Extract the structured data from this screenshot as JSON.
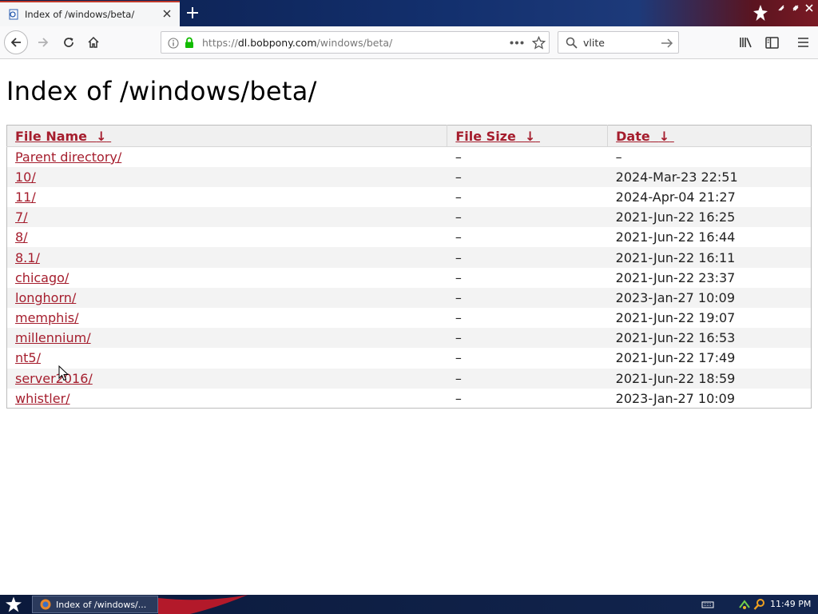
{
  "browser": {
    "tab_title": "Index of /windows/beta/",
    "url_prefix": "https://",
    "url_host": "dl.bobpony.com",
    "url_path": "/windows/beta/",
    "search_value": "vlite"
  },
  "page": {
    "title": "Index of /windows/beta/",
    "columns": [
      "File Name",
      "File Size",
      "Date"
    ],
    "sort_arrow": "↓",
    "rows": [
      {
        "name": "Parent directory/",
        "size": "–",
        "date": "–"
      },
      {
        "name": "10/",
        "size": "–",
        "date": "2024-Mar-23 22:51"
      },
      {
        "name": "11/",
        "size": "–",
        "date": "2024-Apr-04 21:27"
      },
      {
        "name": "7/",
        "size": "–",
        "date": "2021-Jun-22 16:25"
      },
      {
        "name": "8/",
        "size": "–",
        "date": "2021-Jun-22 16:44"
      },
      {
        "name": "8.1/",
        "size": "–",
        "date": "2021-Jun-22 16:11"
      },
      {
        "name": "chicago/",
        "size": "–",
        "date": "2021-Jun-22 23:37"
      },
      {
        "name": "longhorn/",
        "size": "–",
        "date": "2023-Jan-27 10:09"
      },
      {
        "name": "memphis/",
        "size": "–",
        "date": "2021-Jun-22 19:07"
      },
      {
        "name": "millennium/",
        "size": "–",
        "date": "2021-Jun-22 16:53"
      },
      {
        "name": "nt5/",
        "size": "–",
        "date": "2021-Jun-22 17:49"
      },
      {
        "name": "server2016/",
        "size": "–",
        "date": "2021-Jun-22 18:59"
      },
      {
        "name": "whistler/",
        "size": "–",
        "date": "2023-Jan-27 10:09"
      }
    ]
  },
  "taskbar": {
    "task_label": "Index of /windows/...",
    "clock": "11:49 PM"
  },
  "icons": {
    "tab": [
      "page-favicon",
      "close-icon",
      "plus-icon"
    ],
    "window": [
      "minimize-icon",
      "maximize-icon",
      "close-icon"
    ],
    "nav": [
      "back-arrow-icon",
      "forward-arrow-icon",
      "reload-icon",
      "home-icon",
      "info-icon",
      "lock-icon",
      "more-icon",
      "star-icon",
      "search-icon",
      "arrow-right-icon",
      "library-icon",
      "sidebar-icon",
      "menu-icon"
    ],
    "taskbar": [
      "start-star-icon",
      "network-icon",
      "search-icon"
    ]
  },
  "colors": {
    "link": "#a51d2d",
    "lock": "#12bc00",
    "accent_tab": "#c0392b"
  }
}
